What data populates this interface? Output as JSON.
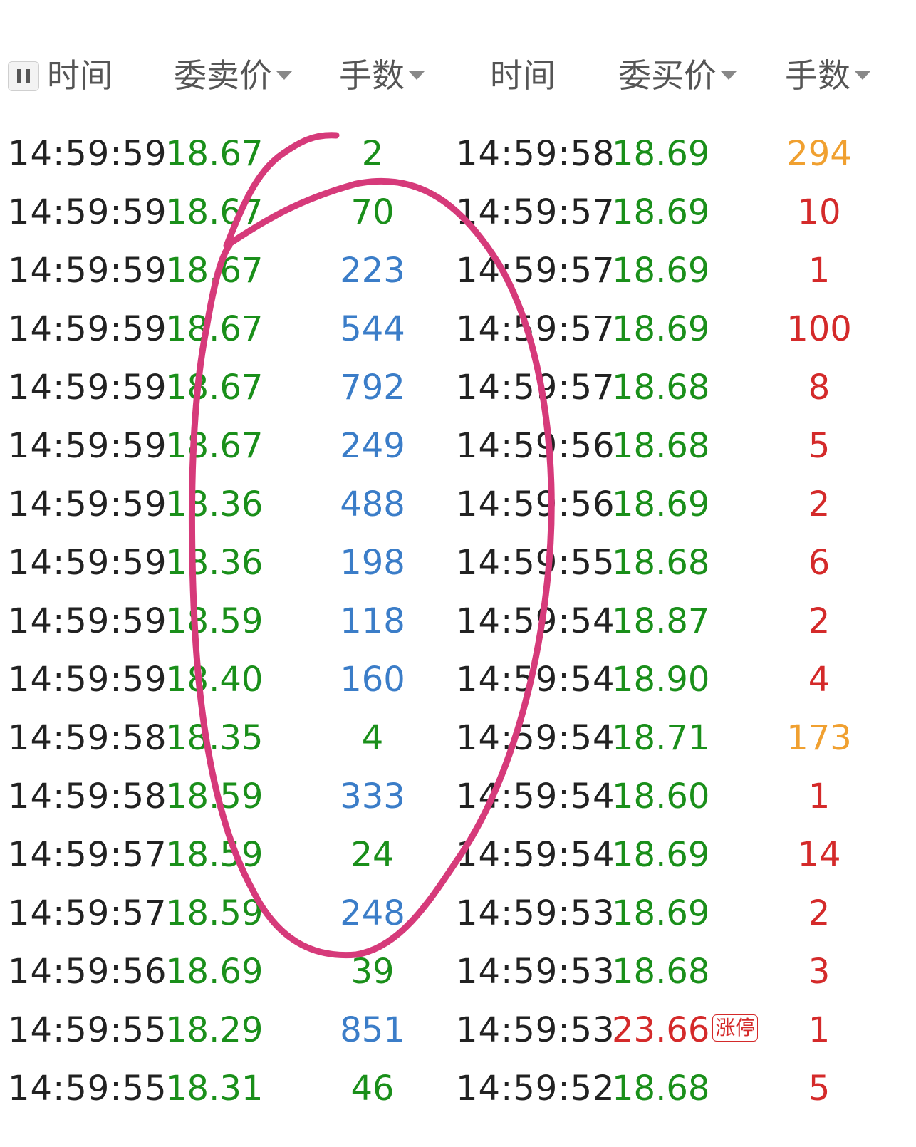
{
  "header": {
    "left": {
      "time": "时间",
      "price": "委卖价",
      "qty": "手数"
    },
    "right": {
      "time": "时间",
      "price": "委买价",
      "qty": "手数"
    }
  },
  "colors": {
    "green": "#1a8f1a",
    "blue": "#3b7dc8",
    "red": "#d42a2a",
    "orange": "#f0a030",
    "annotation": "#d63a7a"
  },
  "sell_rows": [
    {
      "time": "14:59:59",
      "price": "18.67",
      "qty": "2",
      "qty_color": "green"
    },
    {
      "time": "14:59:59",
      "price": "18.67",
      "qty": "70",
      "qty_color": "green"
    },
    {
      "time": "14:59:59",
      "price": "18.67",
      "qty": "223",
      "qty_color": "blue"
    },
    {
      "time": "14:59:59",
      "price": "18.67",
      "qty": "544",
      "qty_color": "blue"
    },
    {
      "time": "14:59:59",
      "price": "18.67",
      "qty": "792",
      "qty_color": "blue"
    },
    {
      "time": "14:59:59",
      "price": "18.67",
      "qty": "249",
      "qty_color": "blue"
    },
    {
      "time": "14:59:59",
      "price": "18.36",
      "qty": "488",
      "qty_color": "blue"
    },
    {
      "time": "14:59:59",
      "price": "18.36",
      "qty": "198",
      "qty_color": "blue"
    },
    {
      "time": "14:59:59",
      "price": "18.59",
      "qty": "118",
      "qty_color": "blue"
    },
    {
      "time": "14:59:59",
      "price": "18.40",
      "qty": "160",
      "qty_color": "blue"
    },
    {
      "time": "14:59:58",
      "price": "18.35",
      "qty": "4",
      "qty_color": "green"
    },
    {
      "time": "14:59:58",
      "price": "18.59",
      "qty": "333",
      "qty_color": "blue"
    },
    {
      "time": "14:59:57",
      "price": "18.59",
      "qty": "24",
      "qty_color": "green"
    },
    {
      "time": "14:59:57",
      "price": "18.59",
      "qty": "248",
      "qty_color": "blue"
    },
    {
      "time": "14:59:56",
      "price": "18.69",
      "qty": "39",
      "qty_color": "green"
    },
    {
      "time": "14:59:55",
      "price": "18.29",
      "qty": "851",
      "qty_color": "blue"
    },
    {
      "time": "14:59:55",
      "price": "18.31",
      "qty": "46",
      "qty_color": "green"
    }
  ],
  "buy_rows": [
    {
      "time": "14:59:58",
      "price": "18.69",
      "price_color": "green",
      "qty": "294",
      "qty_color": "orange"
    },
    {
      "time": "14:59:57",
      "price": "18.69",
      "price_color": "green",
      "qty": "10",
      "qty_color": "red"
    },
    {
      "time": "14:59:57",
      "price": "18.69",
      "price_color": "green",
      "qty": "1",
      "qty_color": "red"
    },
    {
      "time": "14:59:57",
      "price": "18.69",
      "price_color": "green",
      "qty": "100",
      "qty_color": "red"
    },
    {
      "time": "14:59:57",
      "price": "18.68",
      "price_color": "green",
      "qty": "8",
      "qty_color": "red"
    },
    {
      "time": "14:59:56",
      "price": "18.68",
      "price_color": "green",
      "qty": "5",
      "qty_color": "red"
    },
    {
      "time": "14:59:56",
      "price": "18.69",
      "price_color": "green",
      "qty": "2",
      "qty_color": "red"
    },
    {
      "time": "14:59:55",
      "price": "18.68",
      "price_color": "green",
      "qty": "6",
      "qty_color": "red"
    },
    {
      "time": "14:59:54",
      "price": "18.87",
      "price_color": "green",
      "qty": "2",
      "qty_color": "red"
    },
    {
      "time": "14:59:54",
      "price": "18.90",
      "price_color": "green",
      "qty": "4",
      "qty_color": "red"
    },
    {
      "time": "14:59:54",
      "price": "18.71",
      "price_color": "green",
      "qty": "173",
      "qty_color": "orange"
    },
    {
      "time": "14:59:54",
      "price": "18.60",
      "price_color": "green",
      "qty": "1",
      "qty_color": "red"
    },
    {
      "time": "14:59:54",
      "price": "18.69",
      "price_color": "green",
      "qty": "14",
      "qty_color": "red"
    },
    {
      "time": "14:59:53",
      "price": "18.69",
      "price_color": "green",
      "qty": "2",
      "qty_color": "red"
    },
    {
      "time": "14:59:53",
      "price": "18.68",
      "price_color": "green",
      "qty": "3",
      "qty_color": "red"
    },
    {
      "time": "14:59:53",
      "price": "23.66",
      "price_color": "red",
      "badge": "涨停",
      "qty": "1",
      "qty_color": "red"
    },
    {
      "time": "14:59:52",
      "price": "18.68",
      "price_color": "green",
      "qty": "5",
      "qty_color": "red"
    }
  ]
}
